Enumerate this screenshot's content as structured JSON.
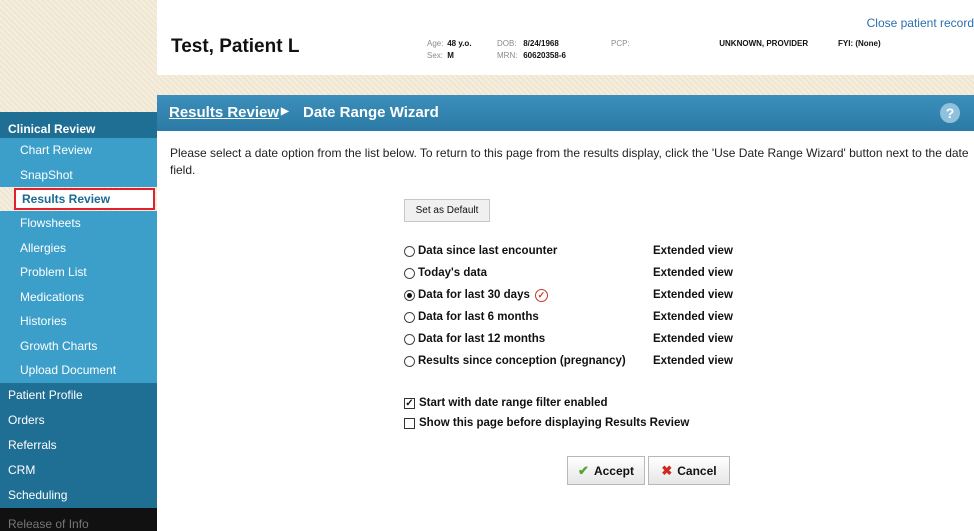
{
  "header": {
    "close_link": "Close patient record",
    "patient_name": "Test, Patient L",
    "age_label": "Age:",
    "age_value": "48 y.o.",
    "sex_label": "Sex:",
    "sex_value": "M",
    "dob_label": "DOB:",
    "dob_value": "8/24/1968",
    "mrn_label": "MRN:",
    "mrn_value": "60620358-6",
    "pcp_label": "PCP:",
    "pcp_value": "UNKNOWN, PROVIDER",
    "fyi_label": "FYI:",
    "fyi_value": "(None)"
  },
  "sidebar": {
    "section_title": "Clinical Review",
    "items": [
      {
        "label": "Chart Review"
      },
      {
        "label": "SnapShot"
      },
      {
        "label": "Results Review"
      },
      {
        "label": "Flowsheets"
      },
      {
        "label": "Allergies"
      },
      {
        "label": "Problem List"
      },
      {
        "label": "Medications"
      },
      {
        "label": "Histories"
      },
      {
        "label": "Growth Charts"
      },
      {
        "label": "Upload Document"
      }
    ],
    "sections": [
      {
        "label": "Patient Profile"
      },
      {
        "label": "Orders"
      },
      {
        "label": "Referrals"
      },
      {
        "label": "CRM"
      },
      {
        "label": "Scheduling"
      }
    ],
    "bottom_label": "Release of Info"
  },
  "main": {
    "breadcrumb_link": "Results Review",
    "breadcrumb_current": "Date Range Wizard",
    "help_icon": "?",
    "instructions": "Please select a date option from the list below. To return to this page from the results display, click the 'Use Date Range Wizard' button next to the date field.",
    "set_default_label": "Set as Default",
    "options": [
      {
        "label": "Data since last encounter",
        "ext": "Extended view",
        "checked": false
      },
      {
        "label": "Today's data",
        "ext": "Extended view",
        "checked": false
      },
      {
        "label": "Data for last 30 days",
        "ext": "Extended view",
        "checked": true
      },
      {
        "label": "Data for last 6 months",
        "ext": "Extended view",
        "checked": false
      },
      {
        "label": "Data for last 12 months",
        "ext": "Extended view",
        "checked": false
      },
      {
        "label": "Results since conception (pregnancy)",
        "ext": "Extended view",
        "checked": false
      }
    ],
    "check_filter_label": "Start with date range filter enabled",
    "check_show_label": "Show this page before displaying Results Review",
    "accept_label": "Accept",
    "cancel_label": "Cancel"
  },
  "colors": {
    "sidebar_dark": "#1f6e94",
    "sidebar_light": "#3c9fc9",
    "highlight_border": "#e0202a",
    "title_bar": "#2b7aa5"
  }
}
